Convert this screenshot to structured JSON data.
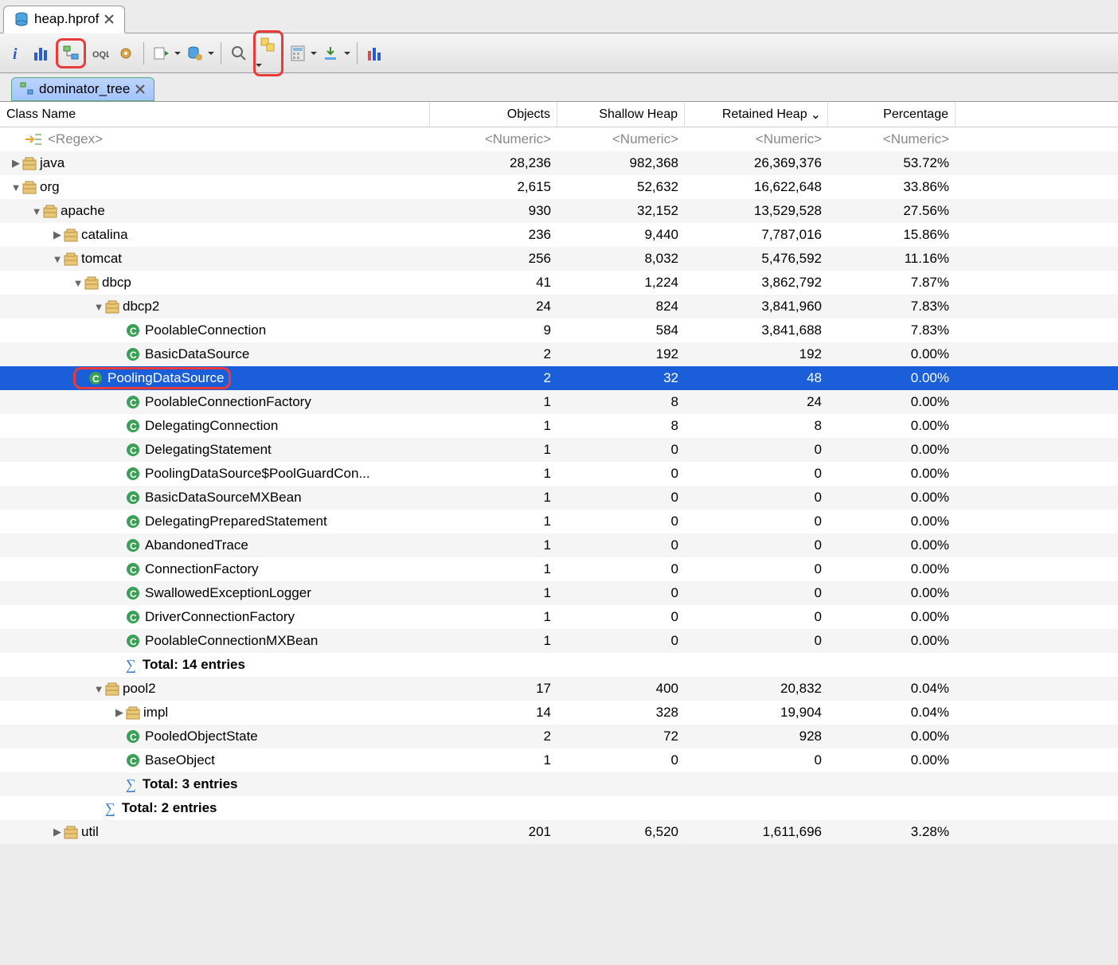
{
  "file_tab": {
    "name": "heap.hprof"
  },
  "view_tab": {
    "name": "dominator_tree"
  },
  "columns": {
    "class_name": "Class Name",
    "objects": "Objects",
    "shallow": "Shallow Heap",
    "retained": "Retained Heap",
    "percentage": "Percentage"
  },
  "filter": {
    "regex": "<Regex>",
    "numeric": "<Numeric>"
  },
  "sort_indicator": "⌄",
  "rows": [
    {
      "kind": "pkg",
      "indent": 0,
      "expander": "▶",
      "name": "java",
      "objects": "28,236",
      "shallow": "982,368",
      "retained": "26,369,376",
      "pct": "53.72%"
    },
    {
      "kind": "pkg",
      "indent": 0,
      "expander": "▼",
      "name": "org",
      "objects": "2,615",
      "shallow": "52,632",
      "retained": "16,622,648",
      "pct": "33.86%"
    },
    {
      "kind": "pkg",
      "indent": 1,
      "expander": "▼",
      "name": "apache",
      "objects": "930",
      "shallow": "32,152",
      "retained": "13,529,528",
      "pct": "27.56%"
    },
    {
      "kind": "pkg",
      "indent": 2,
      "expander": "▶",
      "name": "catalina",
      "objects": "236",
      "shallow": "9,440",
      "retained": "7,787,016",
      "pct": "15.86%"
    },
    {
      "kind": "pkg",
      "indent": 2,
      "expander": "▼",
      "name": "tomcat",
      "objects": "256",
      "shallow": "8,032",
      "retained": "5,476,592",
      "pct": "11.16%"
    },
    {
      "kind": "pkg",
      "indent": 3,
      "expander": "▼",
      "name": "dbcp",
      "objects": "41",
      "shallow": "1,224",
      "retained": "3,862,792",
      "pct": "7.87%"
    },
    {
      "kind": "pkg",
      "indent": 4,
      "expander": "▼",
      "name": "dbcp2",
      "objects": "24",
      "shallow": "824",
      "retained": "3,841,960",
      "pct": "7.83%"
    },
    {
      "kind": "class",
      "indent": 5,
      "name": "PoolableConnection",
      "objects": "9",
      "shallow": "584",
      "retained": "3,841,688",
      "pct": "7.83%"
    },
    {
      "kind": "class",
      "indent": 5,
      "name": "BasicDataSource",
      "objects": "2",
      "shallow": "192",
      "retained": "192",
      "pct": "0.00%"
    },
    {
      "kind": "class",
      "indent": 5,
      "name": "PoolingDataSource",
      "objects": "2",
      "shallow": "32",
      "retained": "48",
      "pct": "0.00%",
      "selected": true,
      "highlight": true
    },
    {
      "kind": "class",
      "indent": 5,
      "name": "PoolableConnectionFactory",
      "objects": "1",
      "shallow": "8",
      "retained": "24",
      "pct": "0.00%"
    },
    {
      "kind": "class",
      "indent": 5,
      "name": "DelegatingConnection",
      "objects": "1",
      "shallow": "8",
      "retained": "8",
      "pct": "0.00%"
    },
    {
      "kind": "class",
      "indent": 5,
      "name": "DelegatingStatement",
      "objects": "1",
      "shallow": "0",
      "retained": "0",
      "pct": "0.00%"
    },
    {
      "kind": "class",
      "indent": 5,
      "name": "PoolingDataSource$PoolGuardCon...",
      "objects": "1",
      "shallow": "0",
      "retained": "0",
      "pct": "0.00%"
    },
    {
      "kind": "class",
      "indent": 5,
      "name": "BasicDataSourceMXBean",
      "objects": "1",
      "shallow": "0",
      "retained": "0",
      "pct": "0.00%"
    },
    {
      "kind": "class",
      "indent": 5,
      "name": "DelegatingPreparedStatement",
      "objects": "1",
      "shallow": "0",
      "retained": "0",
      "pct": "0.00%"
    },
    {
      "kind": "class",
      "indent": 5,
      "name": "AbandonedTrace",
      "objects": "1",
      "shallow": "0",
      "retained": "0",
      "pct": "0.00%"
    },
    {
      "kind": "class",
      "indent": 5,
      "name": "ConnectionFactory",
      "objects": "1",
      "shallow": "0",
      "retained": "0",
      "pct": "0.00%"
    },
    {
      "kind": "class",
      "indent": 5,
      "name": "SwallowedExceptionLogger",
      "objects": "1",
      "shallow": "0",
      "retained": "0",
      "pct": "0.00%"
    },
    {
      "kind": "class",
      "indent": 5,
      "name": "DriverConnectionFactory",
      "objects": "1",
      "shallow": "0",
      "retained": "0",
      "pct": "0.00%"
    },
    {
      "kind": "class",
      "indent": 5,
      "name": "PoolableConnectionMXBean",
      "objects": "1",
      "shallow": "0",
      "retained": "0",
      "pct": "0.00%"
    },
    {
      "kind": "total",
      "indent": 5,
      "name": "Total: 14 entries"
    },
    {
      "kind": "pkg",
      "indent": 4,
      "expander": "▼",
      "name": "pool2",
      "objects": "17",
      "shallow": "400",
      "retained": "20,832",
      "pct": "0.04%"
    },
    {
      "kind": "pkg",
      "indent": 5,
      "expander": "▶",
      "name": "impl",
      "objects": "14",
      "shallow": "328",
      "retained": "19,904",
      "pct": "0.04%"
    },
    {
      "kind": "class",
      "indent": 5,
      "name": "PooledObjectState",
      "objects": "2",
      "shallow": "72",
      "retained": "928",
      "pct": "0.00%"
    },
    {
      "kind": "class",
      "indent": 5,
      "name": "BaseObject",
      "objects": "1",
      "shallow": "0",
      "retained": "0",
      "pct": "0.00%"
    },
    {
      "kind": "total",
      "indent": 5,
      "name": "Total: 3 entries"
    },
    {
      "kind": "total",
      "indent": 4,
      "name": "Total: 2 entries"
    },
    {
      "kind": "pkg",
      "indent": 2,
      "expander": "▶",
      "name": "util",
      "objects": "201",
      "shallow": "6,520",
      "retained": "1,611,696",
      "pct": "3.28%"
    }
  ]
}
